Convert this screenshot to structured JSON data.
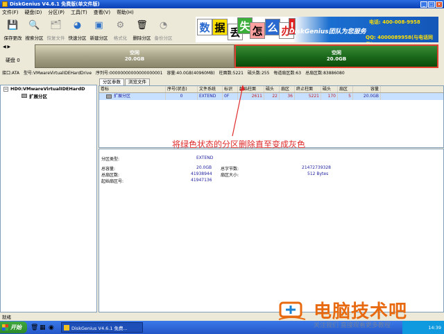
{
  "window": {
    "title": "DiskGenius V4.6.1 免费版(单文件版)"
  },
  "menu": [
    "文件(F)",
    "硬盘(D)",
    "分区(P)",
    "工具(T)",
    "查看(V)",
    "帮助(H)"
  ],
  "toolbar": [
    {
      "label": "保存更改",
      "icon": "save-icon",
      "glyph": "💾",
      "enabled": true
    },
    {
      "label": "搜索分区",
      "icon": "search-icon",
      "glyph": "🔍",
      "enabled": true
    },
    {
      "label": "恢复文件",
      "icon": "recover-icon",
      "glyph": "🗂",
      "enabled": false
    },
    {
      "label": "快速分区",
      "icon": "quick-partition-icon",
      "glyph": "◕",
      "enabled": true
    },
    {
      "label": "新建分区",
      "icon": "new-partition-icon",
      "glyph": "▣",
      "enabled": true
    },
    {
      "label": "格式化",
      "icon": "format-icon",
      "glyph": "⚙",
      "enabled": false
    },
    {
      "label": "删除分区",
      "icon": "delete-partition-icon",
      "glyph": "🗑",
      "enabled": true
    },
    {
      "label": "备份分区",
      "icon": "backup-icon",
      "glyph": "◔",
      "enabled": false
    }
  ],
  "banner": {
    "tiles": [
      "数",
      "据",
      "丢",
      "失",
      "怎",
      "么",
      "办",
      "!"
    ],
    "brand": "DiskGenius团队为您服务",
    "phone1": "电话: 400-008-9958",
    "phone2": "QQ: 4000089958(与电话同号)"
  },
  "disk_nav": {
    "label": "硬盘 0"
  },
  "partitions_bar": [
    {
      "label": "空闲",
      "size": "20.0GB"
    },
    {
      "label": "空闲",
      "size": "20.0GB"
    }
  ],
  "disk_info": {
    "interface": "接口:ATA",
    "model": "型号:VMwareVirtualIDEHardDrive",
    "serial": "序列号:00000000000000000001",
    "capacity": "容量:40.0GB(40960MB)",
    "cylinders": "柱面数:5221",
    "heads": "磁头数:255",
    "sectors_per_track": "每道扇区数:63",
    "total_sectors": "总扇区数:83886080"
  },
  "tree": {
    "root": "HD0:VMwareVirtualIDEHardD",
    "child": "扩展分区"
  },
  "tabs": [
    "分区参数",
    "浏览文件"
  ],
  "partition_table": {
    "headers": [
      "卷标",
      "序号(状态)",
      "文件系统",
      "标识",
      "起始柱面",
      "磁头",
      "扇区",
      "终止柱面",
      "磁头",
      "扇区",
      "容量"
    ],
    "rows": [
      [
        "扩展分区",
        "0",
        "EXTEND",
        "0F",
        "2611",
        "22",
        "36",
        "5221",
        "170",
        "5",
        "20.0GB"
      ]
    ]
  },
  "annotation": "将绿色状态的分区删除直至变成灰色",
  "details": {
    "type_label": "分区类型:",
    "type_value": "EXTEND",
    "capacity_label": "总容量:",
    "capacity_value": "20.0GB",
    "total_bytes_label": "总字节数:",
    "total_bytes_value": "21472739328",
    "sectors_label": "总扇区数:",
    "sectors_value": "41938944",
    "sector_size_label": "扇区大小:",
    "sector_size_value": "512 Bytes",
    "start_sector_label": "起始扇区号:",
    "start_sector_value": "41947136"
  },
  "status": "就绪",
  "taskbar": {
    "start": "开始",
    "task": "DiskGenius V4.6.1 免费...",
    "clock": "14:39"
  },
  "watermark": {
    "text": "电脑技术吧",
    "sub": "关注我们 直接观看更多教程"
  },
  "colors": {
    "free_partition": "#a9a58a",
    "active_partition": "#1c6a1c",
    "highlight_border": "#e04030",
    "annotation": "#e02a2a"
  }
}
